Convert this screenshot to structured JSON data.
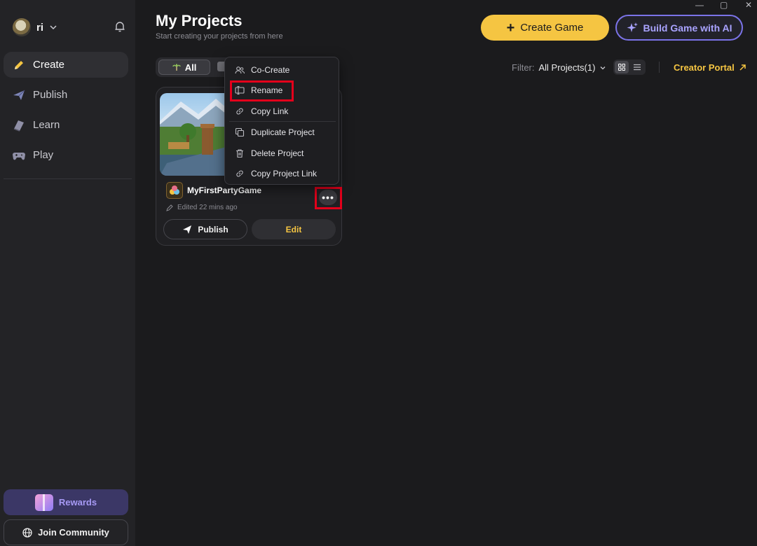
{
  "window": {
    "controls": [
      "—",
      "▢",
      "✕"
    ]
  },
  "sidebar": {
    "user": {
      "name": "ri"
    },
    "nav": [
      {
        "label": "Create",
        "icon": "pencil-icon",
        "active": true
      },
      {
        "label": "Publish",
        "icon": "paper-plane-icon",
        "active": false
      },
      {
        "label": "Learn",
        "icon": "book-icon",
        "active": false
      },
      {
        "label": "Play",
        "icon": "gamepad-icon",
        "active": false
      }
    ],
    "rewards_label": "Rewards",
    "community_label": "Join Community"
  },
  "header": {
    "title": "My Projects",
    "subtitle": "Start creating your projects from here",
    "create_button": "Create Game",
    "ai_button": "Build Game with AI"
  },
  "toolbar": {
    "tab_all": "All",
    "filter_label": "Filter:",
    "filter_value": "All Projects(1)",
    "creator_portal": "Creator Portal"
  },
  "project": {
    "name": "MyFirstPartyGame",
    "edited": "Edited 22 mins ago",
    "publish_label": "Publish",
    "edit_label": "Edit",
    "more_label": "•••"
  },
  "context_menu": {
    "items": [
      {
        "label": "Co-Create",
        "icon": "users-icon"
      },
      {
        "label": "Rename",
        "icon": "rename-icon",
        "highlighted": true
      },
      {
        "label": "Copy Link",
        "icon": "link-icon"
      },
      {
        "label": "Duplicate Project",
        "icon": "duplicate-icon"
      },
      {
        "label": "Delete Project",
        "icon": "trash-icon"
      },
      {
        "label": "Copy Project Link",
        "icon": "link-icon"
      }
    ]
  },
  "colors": {
    "accent_yellow": "#f5c542",
    "ai_purple": "#7b73e8",
    "highlight_red": "#e3001b",
    "background": "#1b1b1d",
    "sidebar": "#232326"
  }
}
